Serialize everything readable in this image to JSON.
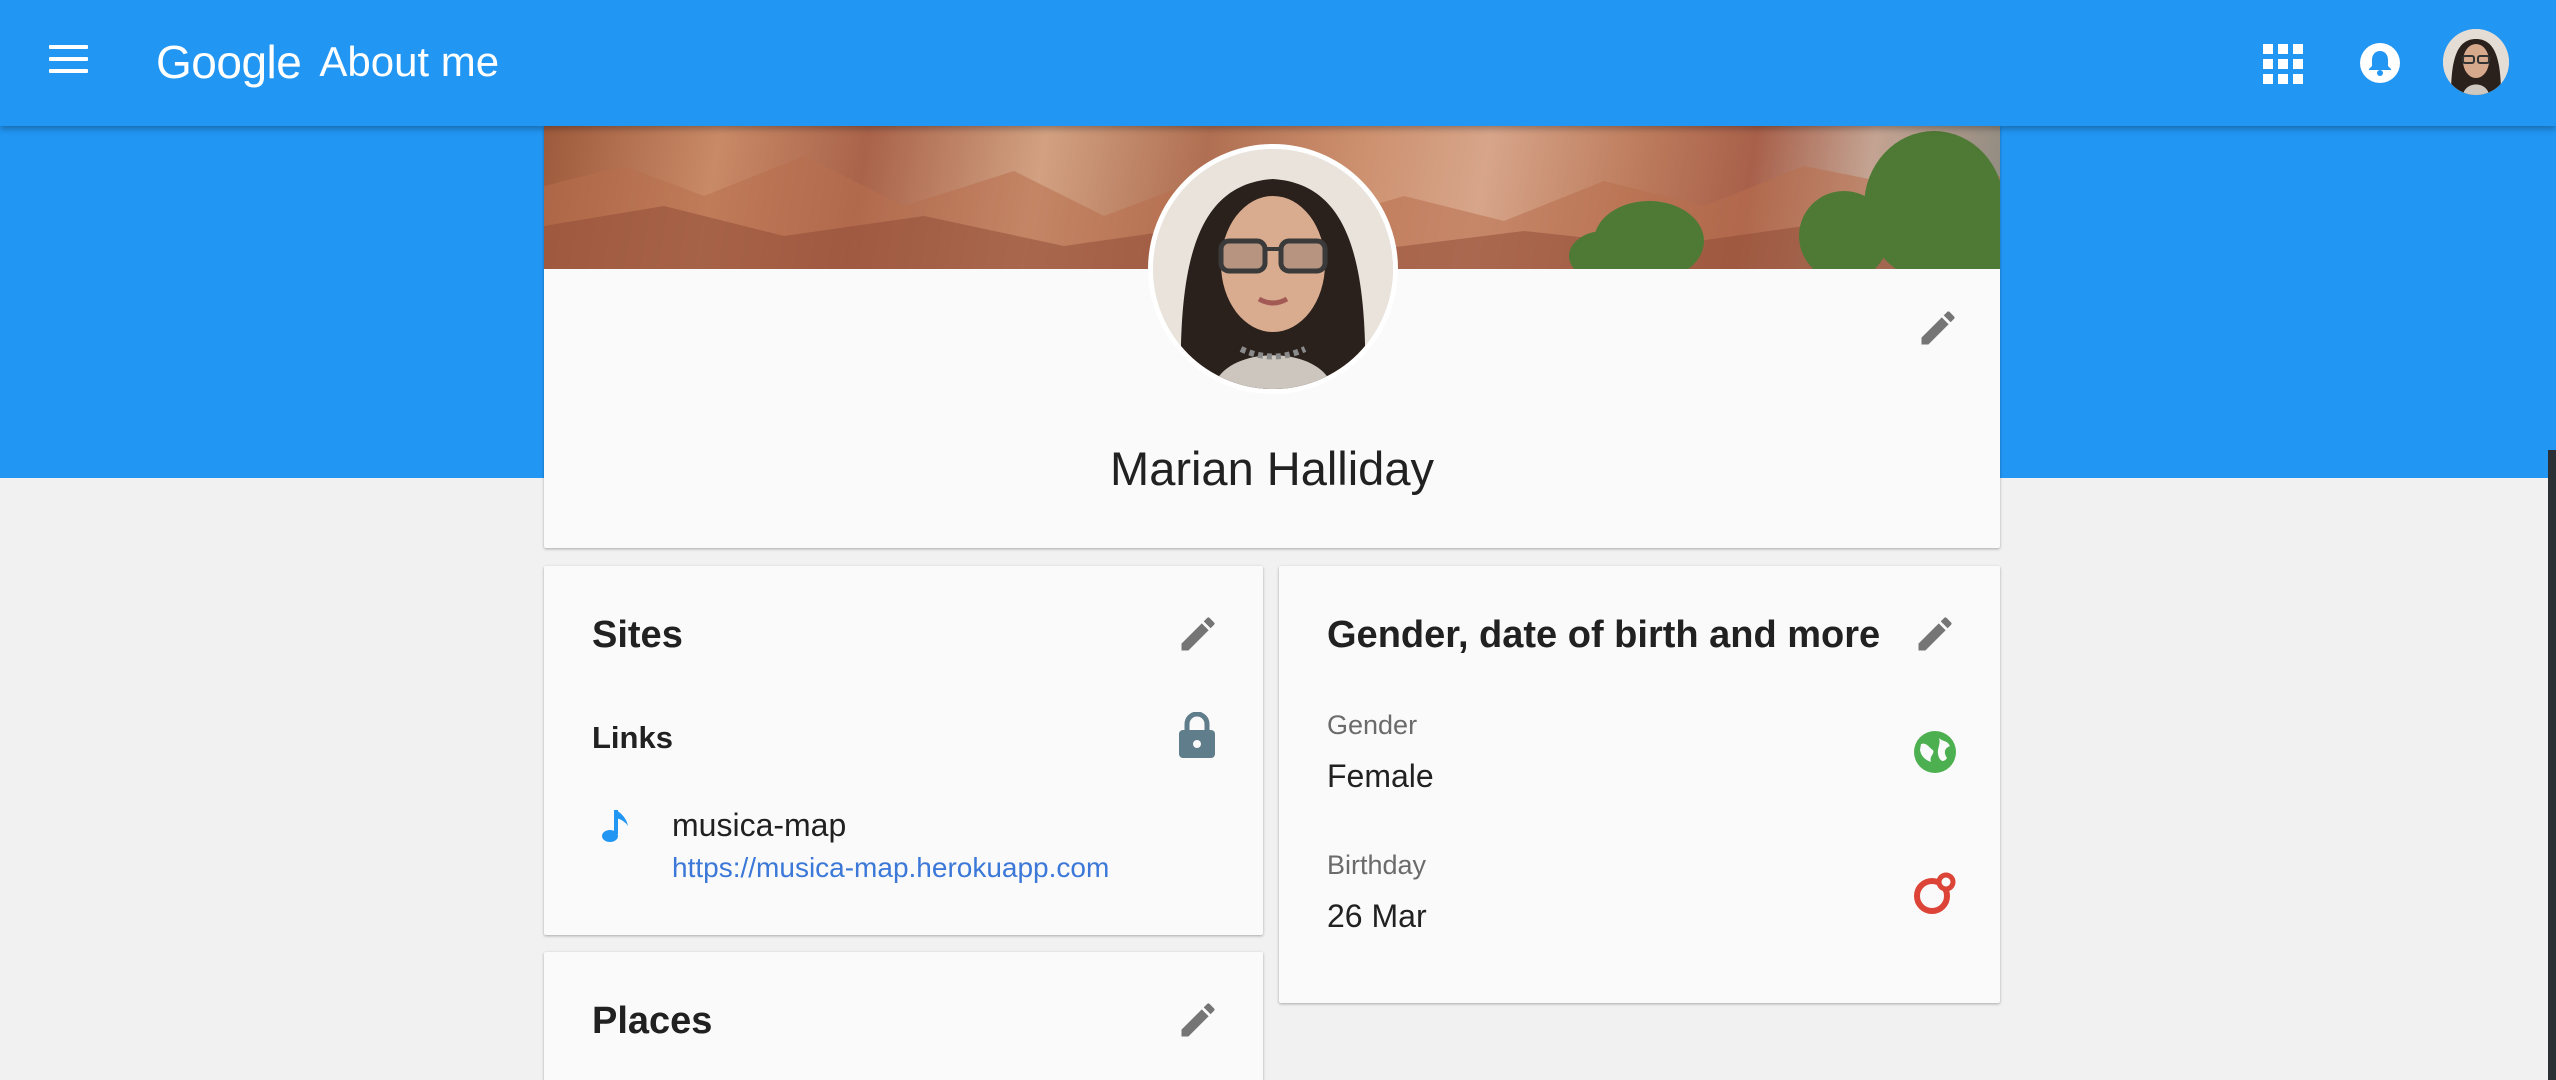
{
  "appbar": {
    "menu_icon": "hamburger-menu-icon",
    "brand": "Google",
    "title": "About me",
    "apps_icon": "apps-grid-icon",
    "notifications_icon": "bell-icon",
    "account_icon": "account-avatar"
  },
  "profile": {
    "name": "Marian Halliday",
    "edit_icon": "pencil-icon"
  },
  "sites": {
    "title": "Sites",
    "links_label": "Links",
    "visibility_icon": "lock-icon",
    "links": [
      {
        "icon": "music-note-icon",
        "name": "musica-map",
        "url": "https://musica-map.herokuapp.com"
      }
    ]
  },
  "basic_info": {
    "title": "Gender, date of birth and more",
    "gender": {
      "label": "Gender",
      "value": "Female",
      "visibility_icon": "globe-icon"
    },
    "birthday": {
      "label": "Birthday",
      "value": "26 Mar",
      "visibility_icon": "circles-icon"
    }
  },
  "places": {
    "title": "Places"
  },
  "colors": {
    "primary_blue": "#2196f3",
    "link_blue": "#3b78d8",
    "public_green": "#4caf50",
    "circles_red": "#db4437",
    "lock_grey": "#607d8b"
  }
}
